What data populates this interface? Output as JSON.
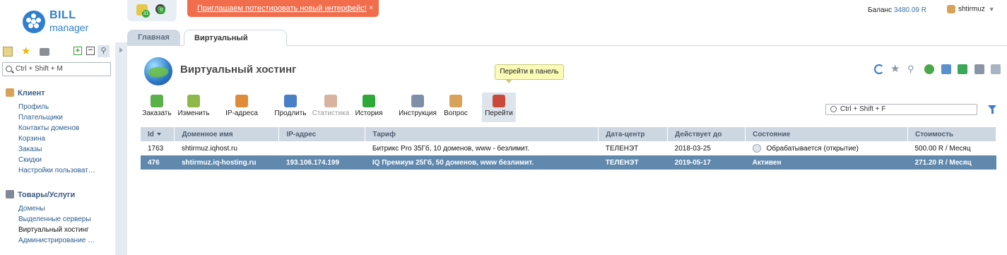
{
  "logo": {
    "line1": "BILL",
    "line2": "manager"
  },
  "status": {
    "badge1": "31",
    "badge2": "0"
  },
  "promo": {
    "text": "Приглашаем потестировать новый интерфейс!",
    "close": "×"
  },
  "balance": {
    "label": "Баланс",
    "amount": "3480.09 R"
  },
  "user": {
    "name": "shtirmuz"
  },
  "tabs": [
    {
      "label": "Главная"
    },
    {
      "label": "Виртуальный хостинг"
    }
  ],
  "sidebar": {
    "search_placeholder": "Ctrl + Shift + M",
    "groups": [
      {
        "title": "Клиент",
        "items": [
          "Профиль",
          "Плательщики",
          "Контакты доменов",
          "Корзина",
          "Заказы",
          "Скидки",
          "Настройки пользоват…"
        ]
      },
      {
        "title": "Товары/Услуги",
        "items": [
          "Домены",
          "Выделенные серверы",
          "Виртуальный хостинг",
          "Администрирование …"
        ]
      }
    ]
  },
  "page": {
    "title": "Виртуальный хостинг",
    "tooltip": "Перейти в панель",
    "filter_placeholder": "Ctrl + Shift + F"
  },
  "toolbar": [
    {
      "label": "Заказать",
      "icon": "order-icon",
      "color": "#5bb04a"
    },
    {
      "label": "Изменить",
      "icon": "edit-icon",
      "color": "#8fb84a"
    },
    {
      "label": "IP-адреса",
      "icon": "ip-icon",
      "color": "#e08b3a"
    },
    {
      "label": "Продлить",
      "icon": "renew-icon",
      "color": "#4a7fc6"
    },
    {
      "label": "Статистика",
      "icon": "stats-icon",
      "color": "#d7b3a0"
    },
    {
      "label": "История",
      "icon": "history-icon",
      "color": "#2fa83a"
    },
    {
      "label": "Инструкция",
      "icon": "manual-icon",
      "color": "#7f8fa8"
    },
    {
      "label": "Вопрос",
      "icon": "question-icon",
      "color": "#d9a25b"
    },
    {
      "label": "Перейти",
      "icon": "goto-icon",
      "color": "#c94a3a"
    }
  ],
  "table": {
    "headers": [
      "Id",
      "Доменное имя",
      "IP-адрес",
      "Тариф",
      "Дата-центр",
      "Действует до",
      "Состояние",
      "Стоимость"
    ],
    "rows": [
      [
        "1763",
        "shtirmuz.iqhost.ru",
        "",
        "Битрикс Pro 35Гб, 10 доменов, www - безлимит.",
        "ТЕЛЕНЭТ",
        "2018-03-25",
        "Обрабатывается (открытие)",
        "500.00 R / Месяц"
      ],
      [
        "476",
        "shtirmuz.iq-hosting.ru",
        "193.106.174.199",
        "IQ Премиум 25Гб, 50 доменов, www безлимит.",
        "ТЕЛЕНЭТ",
        "2019-05-17",
        "Активен",
        "271.20 R / Месяц"
      ]
    ]
  },
  "colors": {
    "accent": "#2f7fd0",
    "promo": "#f26d4c",
    "selected_row": "#6189ae",
    "header_row": "#ccd7e2"
  }
}
